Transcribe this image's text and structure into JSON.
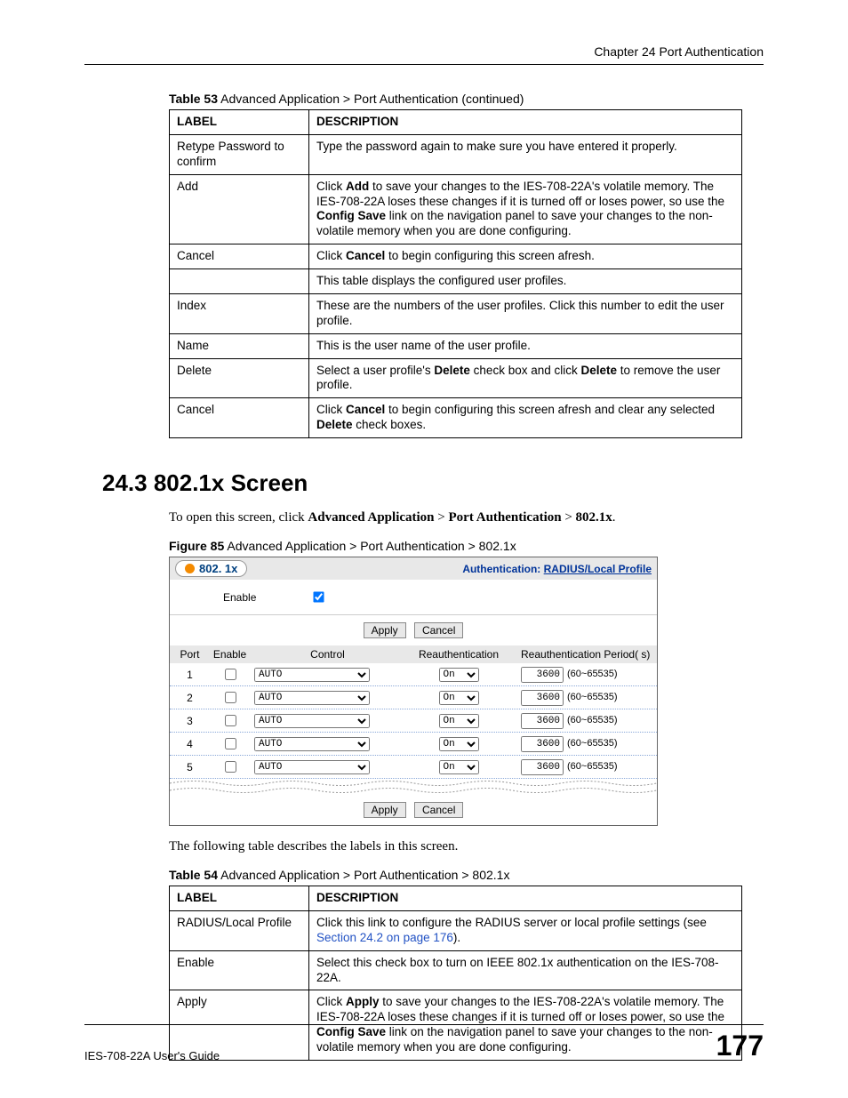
{
  "chapter_header": "Chapter 24 Port Authentication",
  "table53": {
    "caption_bold": "Table 53",
    "caption_rest": "   Advanced Application > Port Authentication (continued)",
    "header_label": "LABEL",
    "header_desc": "DESCRIPTION",
    "rows": [
      {
        "label": "Retype Password to confirm",
        "desc_plain": "Type the password again to make sure you have entered it properly."
      },
      {
        "label": "Add",
        "desc_html": "Click <b>Add</b> to save your changes to the IES-708-22A's volatile memory. The IES-708-22A loses these changes if it is turned off or loses power, so use the <b>Config Save</b> link on the navigation panel to save your changes to the non-volatile memory when you are done configuring."
      },
      {
        "label": "Cancel",
        "desc_html": "Click <b>Cancel</b> to begin configuring this screen afresh."
      },
      {
        "label": "",
        "desc_plain": "This table displays the configured user profiles."
      },
      {
        "label": "Index",
        "desc_plain": "These are the numbers of the user profiles. Click this number to edit the user profile."
      },
      {
        "label": "Name",
        "desc_plain": "This is the user name of the user profile."
      },
      {
        "label": "Delete",
        "desc_html": "Select a user profile's <b>Delete</b> check box and click <b>Delete</b> to remove the user profile."
      },
      {
        "label": "Cancel",
        "desc_html": "Click <b>Cancel</b> to begin configuring this screen afresh and clear any selected <b>Delete</b> check boxes."
      }
    ]
  },
  "section_heading": "24.3  802.1x Screen",
  "intro_text_pre": "To open this screen, click ",
  "intro_bold1": "Advanced Application",
  "intro_sep": " > ",
  "intro_bold2": "Port Authentication",
  "intro_bold3": "802.1x",
  "figure_caption_bold": "Figure 85",
  "figure_caption_rest": "   Advanced Application > Port Authentication > 802.1x",
  "figure": {
    "title": "802. 1x",
    "auth_prefix": "Authentication: ",
    "auth_link": "RADIUS/Local Profile",
    "enable_label": "Enable",
    "apply_label": "Apply",
    "cancel_label": "Cancel",
    "headers": {
      "port": "Port",
      "enable": "Enable",
      "control": "Control",
      "reauth": "Reauthentication",
      "period": "Reauthentication Period( s)"
    },
    "control_option": "AUTO",
    "reauth_option": "On",
    "period_value": "3600",
    "range": "(60~65535)",
    "ports": [
      1,
      2,
      3,
      4,
      5
    ]
  },
  "post_figure_text": "The following table describes the labels in this screen.",
  "table54": {
    "caption_bold": "Table 54",
    "caption_rest": "   Advanced Application > Port Authentication > 802.1x",
    "header_label": "LABEL",
    "header_desc": "DESCRIPTION",
    "rows": [
      {
        "label": "RADIUS/Local Profile",
        "desc_html": "Click this link to configure the RADIUS server or local profile settings (see <span class='link-blue'>Section 24.2 on page 176</span>)."
      },
      {
        "label": "Enable",
        "desc_plain": "Select this check box to turn on IEEE 802.1x authentication on the IES-708-22A."
      },
      {
        "label": "Apply",
        "desc_html": "Click <b>Apply</b> to save your changes to the IES-708-22A's volatile memory. The IES-708-22A loses these changes if it is turned off or loses power, so use the <b>Config Save</b> link on the navigation panel to save your changes to the non-volatile memory when you are done configuring."
      }
    ]
  },
  "footer_guide": "IES-708-22A User's Guide",
  "footer_page": "177"
}
